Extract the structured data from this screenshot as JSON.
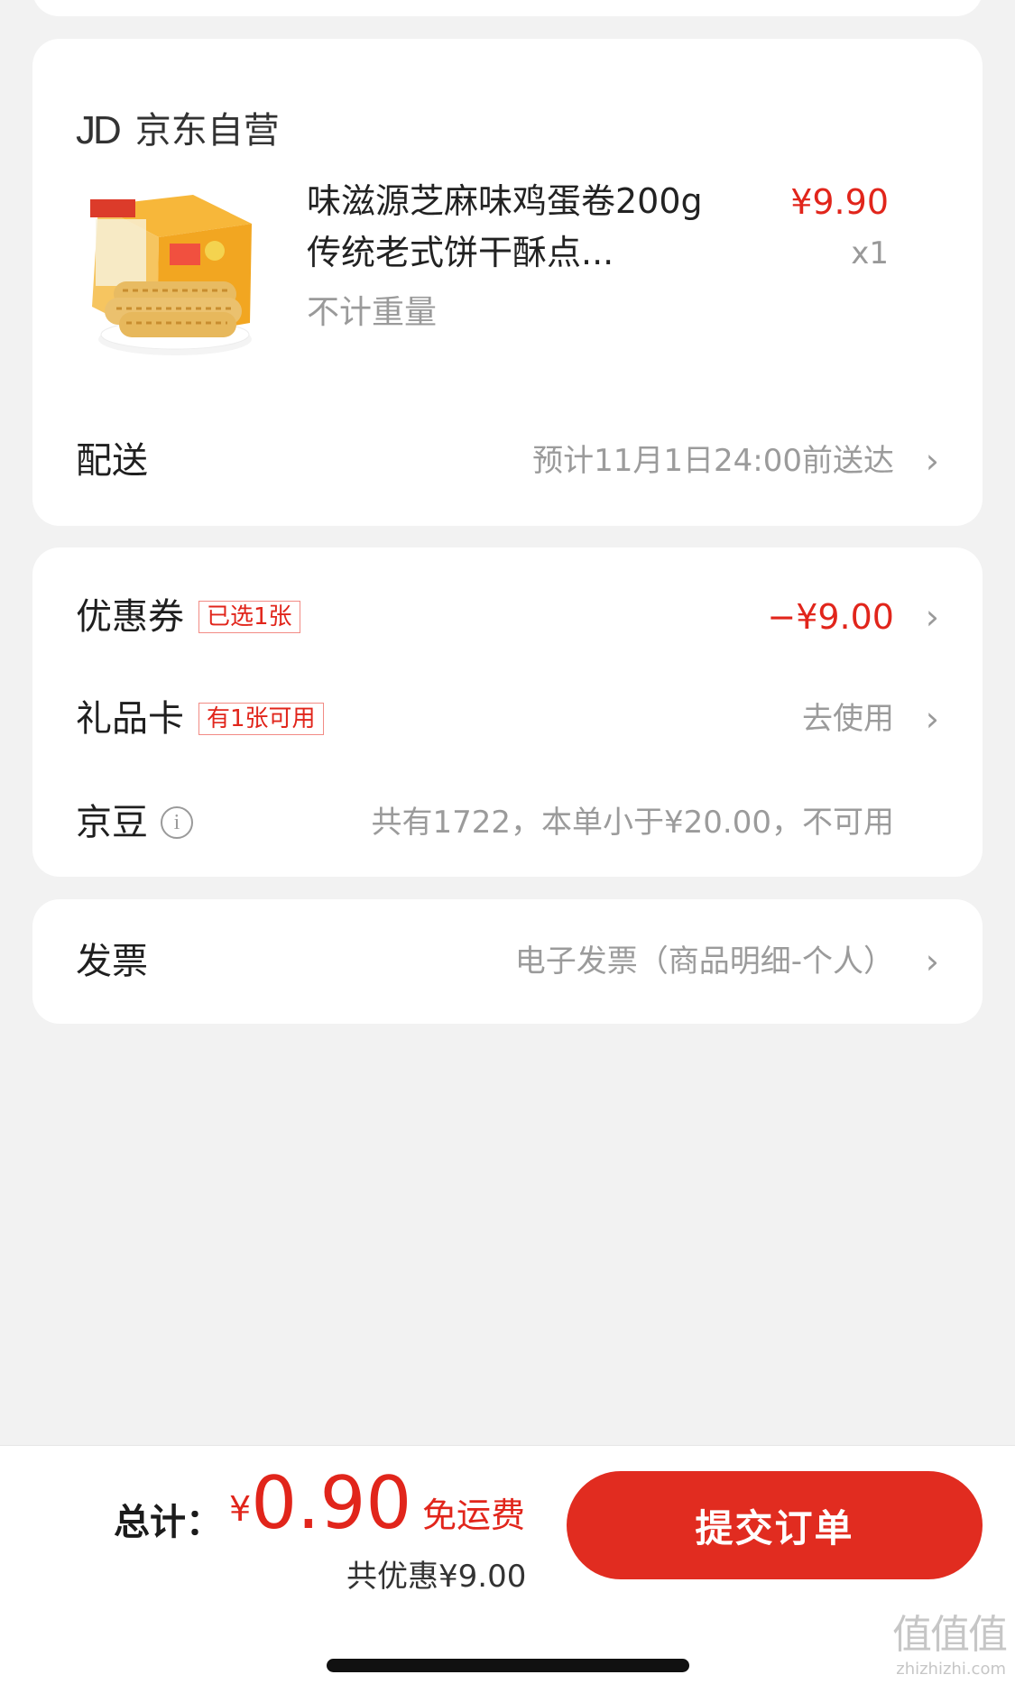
{
  "store": {
    "logo_text": "JD",
    "name": "京东自营"
  },
  "product": {
    "image_icon": "egg-roll-box-image",
    "title": "味滋源芝麻味鸡蛋卷200g传统老式饼干酥点...",
    "spec": "不计重量",
    "price": "¥9.90",
    "quantity": "x1"
  },
  "delivery": {
    "label": "配送",
    "value": "预计11月1日24:00前送达"
  },
  "discounts": {
    "coupon": {
      "label": "优惠券",
      "tag": "已选1张",
      "value": "−¥9.00"
    },
    "gift_card": {
      "label": "礼品卡",
      "tag": "有1张可用",
      "value": "去使用"
    },
    "beans": {
      "label": "京豆",
      "info_icon": "i",
      "value": "共有1722，本单小于¥20.00，不可用"
    }
  },
  "invoice": {
    "label": "发票",
    "value": "电子发票（商品明细-个人）"
  },
  "footer": {
    "total_label": "总计：",
    "currency_symbol": "¥",
    "total_amount": "0.90",
    "shipping_note": "免运费",
    "saving_note": "共优惠¥9.00",
    "submit_label": "提交订单"
  },
  "watermark": {
    "main": "值值值",
    "url": "zhizhizhi.com"
  },
  "colors": {
    "accent": "#e1251b",
    "button": "#e12c20",
    "background": "#f2f2f2",
    "card": "#ffffff"
  },
  "icons": {
    "chevron": "chevron-right-icon",
    "info": "info-icon"
  }
}
